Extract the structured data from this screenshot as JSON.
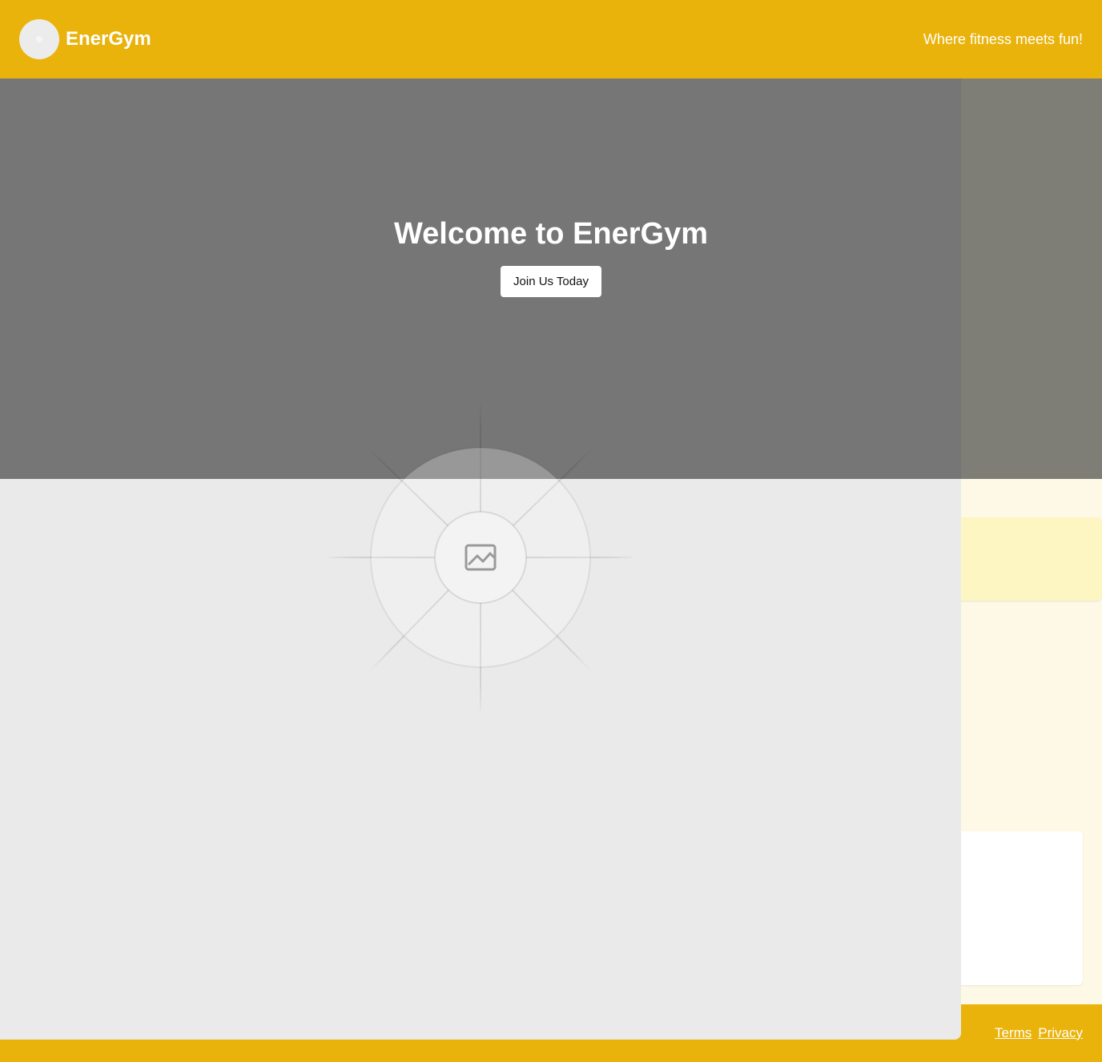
{
  "header": {
    "brand_name": "EnerGym",
    "tagline": "Where fitness meets fun!"
  },
  "hero": {
    "title": "Welcome to EnerGym",
    "cta_label": "Join Us Today"
  },
  "footer": {
    "links": [
      {
        "label": "Terms"
      },
      {
        "label": "Privacy"
      }
    ]
  },
  "colors": {
    "brand_yellow": "#e9b30b",
    "page_background": "#fdf9e6",
    "placeholder_gray": "#eaeaea",
    "hero_overlay": "#767676"
  },
  "icons": {
    "logo": "logo-icon",
    "image_placeholder": "image-placeholder-icon"
  }
}
